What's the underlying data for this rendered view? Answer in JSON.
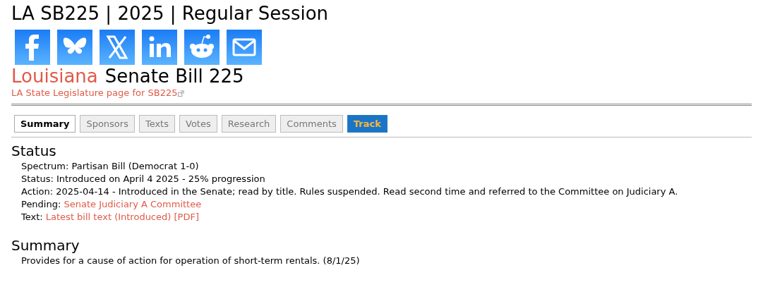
{
  "page_title": "LA SB225 | 2025 | Regular Session",
  "share_icons": [
    {
      "kind": "facebook"
    },
    {
      "kind": "bluesky"
    },
    {
      "kind": "x"
    },
    {
      "kind": "linkedin"
    },
    {
      "kind": "reddit"
    },
    {
      "kind": "email"
    }
  ],
  "bill_heading": {
    "state": "Louisiana",
    "title": "Senate Bill 225"
  },
  "legislature_link": "LA State Legislature page for SB225",
  "tabs": [
    {
      "label": "Summary",
      "selected": true,
      "kind": "tab"
    },
    {
      "label": "Sponsors",
      "selected": false,
      "kind": "tab"
    },
    {
      "label": "Texts",
      "selected": false,
      "kind": "tab"
    },
    {
      "label": "Votes",
      "selected": false,
      "kind": "tab"
    },
    {
      "label": "Research",
      "selected": false,
      "kind": "tab"
    },
    {
      "label": "Comments",
      "selected": false,
      "kind": "tab"
    },
    {
      "label": "Track",
      "selected": false,
      "kind": "action"
    }
  ],
  "status": {
    "heading": "Status",
    "lines": [
      {
        "kind": "text",
        "text": "Spectrum: Partisan Bill (Democrat 1-0)"
      },
      {
        "kind": "text",
        "text": "Status: Introduced on April 4 2025 - 25% progression"
      },
      {
        "kind": "text",
        "text": "Action: 2025-04-14 - Introduced in the Senate; read by title. Rules suspended. Read second time and referred to the Committee on Judiciary A."
      },
      {
        "kind": "link",
        "label": "Pending:",
        "link": "Senate Judiciary A Committee"
      },
      {
        "kind": "link",
        "label": "Text:",
        "link": "Latest bill text (Introduced) [PDF]"
      }
    ]
  },
  "summary": {
    "heading": "Summary",
    "text": "Provides for a cause of action for operation of short-term rentals. (8/1/25)"
  }
}
